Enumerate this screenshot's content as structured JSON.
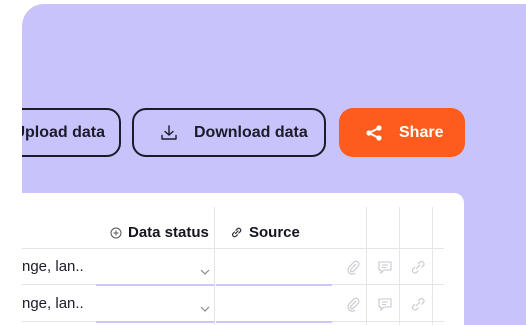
{
  "toolbar": {
    "upload_label": "Upload data",
    "download_label": "Download data",
    "share_label": "Share"
  },
  "table": {
    "columns": [
      {
        "label": "Data status",
        "icon": "info-circle-icon"
      },
      {
        "label": "Source",
        "icon": "link-icon"
      }
    ],
    "rows": [
      {
        "name": "nge, lan..",
        "data_status": ""
      },
      {
        "name": "nge, lan..",
        "data_status": ""
      }
    ]
  },
  "colors": {
    "background_panel": "#c8c4fb",
    "share_accent": "#fd5c1c",
    "text": "#1b1b2a"
  }
}
